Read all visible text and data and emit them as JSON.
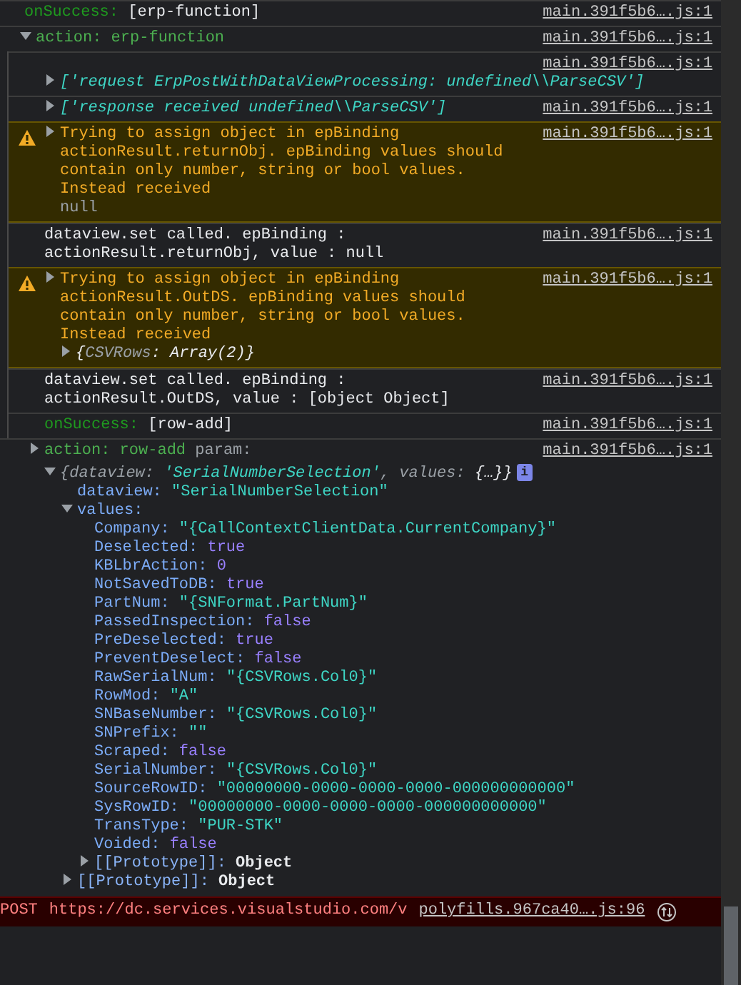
{
  "messages": [
    {
      "kind": "success",
      "label": "onSuccess:",
      "value": "[erp-function]",
      "source": "main.391f5b6….js:1"
    },
    {
      "kind": "group",
      "expanded": true,
      "title": "action: erp-function",
      "source": "main.391f5b6….js:1",
      "children": [
        {
          "kind": "array",
          "expanded": false,
          "text": "['request ErpPostWithDataViewProcessing: undefined\\\\ParseCSV']",
          "source": "main.391f5b6….js:1"
        },
        {
          "kind": "array",
          "expanded": false,
          "text": "['response received undefined\\\\ParseCSV']",
          "source": "main.391f5b6….js:1"
        },
        {
          "kind": "warning",
          "expanded": false,
          "text": "Trying to assign object in epBinding actionResult.returnObj. epBinding values should contain only number, string or bool values. Instead received",
          "value": {
            "kind": "null",
            "text": "null"
          },
          "source": "main.391f5b6….js:1"
        },
        {
          "kind": "log",
          "text": "dataview.set called. epBinding : actionResult.returnObj, value : null",
          "source": "main.391f5b6….js:1"
        },
        {
          "kind": "warning",
          "expanded": false,
          "text": "Trying to assign object in epBinding actionResult.OutDS. epBinding values should contain only number, string or bool values. Instead received",
          "value": {
            "kind": "object",
            "expanded": false,
            "parts": [
              {
                "kind": "plain",
                "text": "{"
              },
              {
                "kind": "key",
                "text": "CSVRows"
              },
              {
                "kind": "plain",
                "text": ": Array(2)}"
              }
            ]
          },
          "source": "main.391f5b6….js:1"
        },
        {
          "kind": "log",
          "text": "dataview.set called. epBinding : actionResult.OutDS, value : [object Object]",
          "source": "main.391f5b6….js:1"
        },
        {
          "kind": "success",
          "label": "onSuccess:",
          "value": "[row-add]",
          "source": "main.391f5b6….js:1"
        }
      ]
    },
    {
      "kind": "object-log",
      "expanded": false,
      "title": "action: row-add",
      "param": "param:",
      "source": "main.391f5b6….js:1",
      "object": {
        "expanded": true,
        "info": "i",
        "parts": [
          {
            "kind": "key",
            "text": "{dataview: "
          },
          {
            "kind": "string",
            "text": "'SerialNumberSelection'"
          },
          {
            "kind": "key",
            "text": ", values: "
          },
          {
            "kind": "plain",
            "text": "{…}}"
          }
        ],
        "children": [
          {
            "key": "dataview:",
            "value": "\"SerialNumberSelection\"",
            "kind": "string"
          },
          {
            "key": "values:",
            "kind": "object",
            "expanded": true,
            "children": [
              {
                "key": "Company:",
                "value": "\"{CallContextClientData.CurrentCompany}\"",
                "kind": "string"
              },
              {
                "key": "Deselected:",
                "value": "true",
                "kind": "boolean"
              },
              {
                "key": "KBLbrAction:",
                "value": "0",
                "kind": "number"
              },
              {
                "key": "NotSavedToDB:",
                "value": "true",
                "kind": "boolean"
              },
              {
                "key": "PartNum:",
                "value": "\"{SNFormat.PartNum}\"",
                "kind": "string"
              },
              {
                "key": "PassedInspection:",
                "value": "false",
                "kind": "boolean"
              },
              {
                "key": "PreDeselected:",
                "value": "true",
                "kind": "boolean"
              },
              {
                "key": "PreventDeselect:",
                "value": "false",
                "kind": "boolean"
              },
              {
                "key": "RawSerialNum:",
                "value": "\"{CSVRows.Col0}\"",
                "kind": "string"
              },
              {
                "key": "RowMod:",
                "value": "\"A\"",
                "kind": "string"
              },
              {
                "key": "SNBaseNumber:",
                "value": "\"{CSVRows.Col0}\"",
                "kind": "string"
              },
              {
                "key": "SNPrefix:",
                "value": "\"\"",
                "kind": "string"
              },
              {
                "key": "Scraped:",
                "value": "false",
                "kind": "boolean"
              },
              {
                "key": "SerialNumber:",
                "value": "\"{CSVRows.Col0}\"",
                "kind": "string"
              },
              {
                "key": "SourceRowID:",
                "value": "\"00000000-0000-0000-0000-000000000000\"",
                "kind": "string"
              },
              {
                "key": "SysRowID:",
                "value": "\"00000000-0000-0000-0000-000000000000\"",
                "kind": "string"
              },
              {
                "key": "TransType:",
                "value": "\"PUR-STK\"",
                "kind": "string"
              },
              {
                "key": "Voided:",
                "value": "false",
                "kind": "boolean"
              },
              {
                "key": "[[Prototype]]:",
                "value": "Object",
                "kind": "proto",
                "expanded": false
              }
            ]
          },
          {
            "key": "[[Prototype]]:",
            "value": "Object",
            "kind": "proto",
            "expanded": false
          }
        ]
      }
    },
    {
      "kind": "network-error",
      "method": "POST",
      "url": "https://dc.services.visualstudio.com/v",
      "source": "polyfills.967ca40….js:96"
    }
  ]
}
